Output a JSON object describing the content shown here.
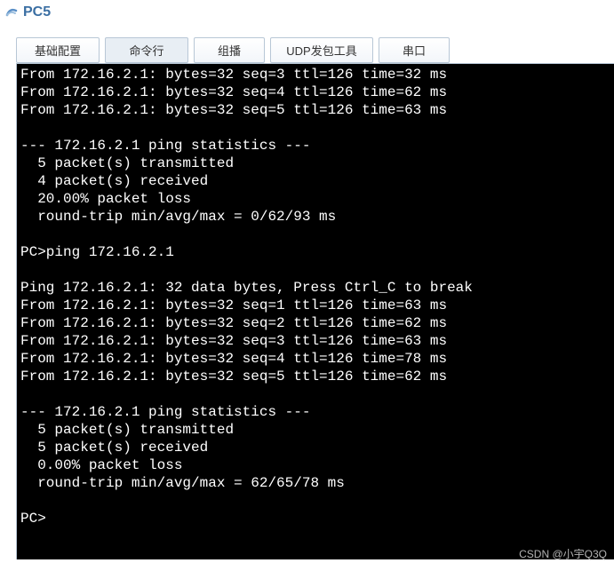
{
  "window": {
    "title": "PC5"
  },
  "tabs": [
    {
      "label": "基础配置"
    },
    {
      "label": "命令行"
    },
    {
      "label": "组播"
    },
    {
      "label": "UDP发包工具"
    },
    {
      "label": "串口"
    }
  ],
  "terminal": {
    "lines": [
      "From 172.16.2.1: bytes=32 seq=3 ttl=126 time=32 ms",
      "From 172.16.2.1: bytes=32 seq=4 ttl=126 time=62 ms",
      "From 172.16.2.1: bytes=32 seq=5 ttl=126 time=63 ms",
      "",
      "--- 172.16.2.1 ping statistics ---",
      "  5 packet(s) transmitted",
      "  4 packet(s) received",
      "  20.00% packet loss",
      "  round-trip min/avg/max = 0/62/93 ms",
      "",
      "PC>ping 172.16.2.1",
      "",
      "Ping 172.16.2.1: 32 data bytes, Press Ctrl_C to break",
      "From 172.16.2.1: bytes=32 seq=1 ttl=126 time=63 ms",
      "From 172.16.2.1: bytes=32 seq=2 ttl=126 time=62 ms",
      "From 172.16.2.1: bytes=32 seq=3 ttl=126 time=63 ms",
      "From 172.16.2.1: bytes=32 seq=4 ttl=126 time=78 ms",
      "From 172.16.2.1: bytes=32 seq=5 ttl=126 time=62 ms",
      "",
      "--- 172.16.2.1 ping statistics ---",
      "  5 packet(s) transmitted",
      "  5 packet(s) received",
      "  0.00% packet loss",
      "  round-trip min/avg/max = 62/65/78 ms",
      "",
      "PC>"
    ]
  },
  "watermark": "CSDN @小宇Q3Q"
}
